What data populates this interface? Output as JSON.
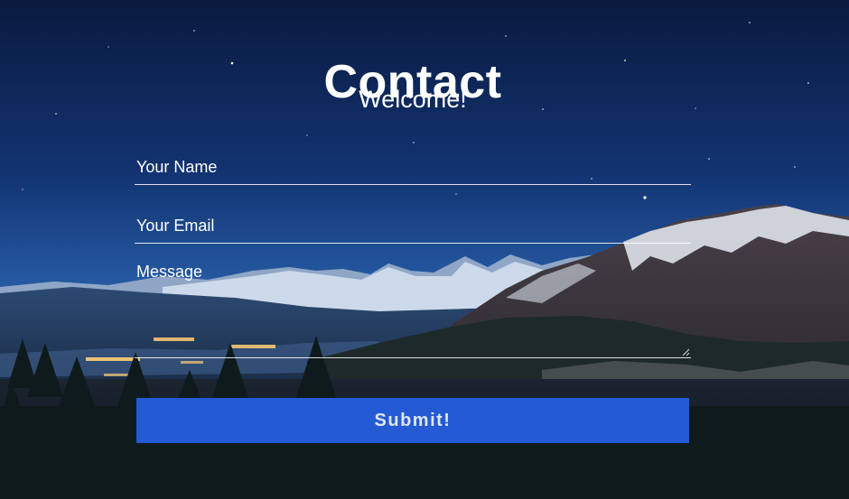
{
  "header": {
    "title": "Contact",
    "subtitle": "Welcome!"
  },
  "form": {
    "name_placeholder": "Your Name",
    "email_placeholder": "Your Email",
    "message_placeholder": "Message",
    "submit_label": "Submit!"
  },
  "colors": {
    "sky_top": "#0b1f4a",
    "sky_horizon": "#2f6bb8",
    "button": "#2660e2",
    "text": "#ffffff"
  }
}
